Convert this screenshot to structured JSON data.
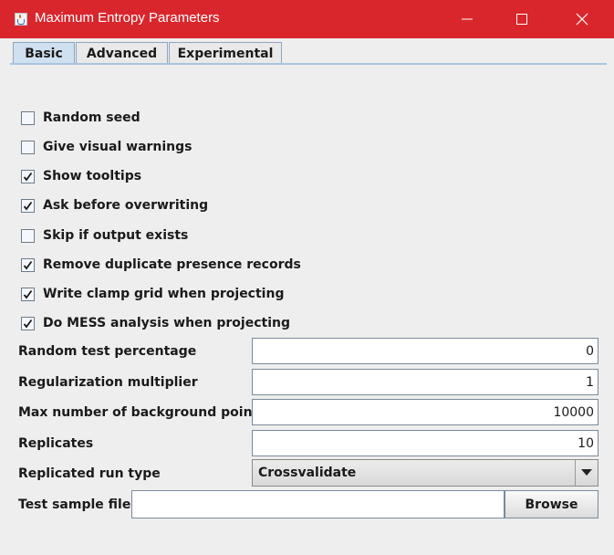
{
  "window": {
    "title": "Maximum Entropy Parameters",
    "icon": "java-cup-icon",
    "controls": [
      "minimize-icon",
      "maximize-icon",
      "close-icon"
    ],
    "titlebar_color": "#d9262c"
  },
  "tabs": [
    {
      "label": "Basic",
      "selected": true
    },
    {
      "label": "Advanced",
      "selected": false
    },
    {
      "label": "Experimental",
      "selected": false
    }
  ],
  "checkboxes": [
    {
      "label": "Random seed",
      "checked": false
    },
    {
      "label": "Give visual warnings",
      "checked": false
    },
    {
      "label": "Show tooltips",
      "checked": true
    },
    {
      "label": "Ask before overwriting",
      "checked": true
    },
    {
      "label": "Skip if output exists",
      "checked": false
    },
    {
      "label": "Remove duplicate presence records",
      "checked": true
    },
    {
      "label": "Write clamp grid when projecting",
      "checked": true
    },
    {
      "label": "Do MESS analysis when projecting",
      "checked": true
    }
  ],
  "fields": [
    {
      "label": "Random test percentage",
      "value": "0"
    },
    {
      "label": "Regularization multiplier",
      "value": "1"
    },
    {
      "label": "Max number of background points",
      "value": "10000"
    },
    {
      "label": "Replicates",
      "value": "10"
    }
  ],
  "run_type": {
    "label": "Replicated run type",
    "value": "Crossvalidate"
  },
  "test_sample": {
    "label": "Test sample file",
    "value": "",
    "button_label": "Browse"
  }
}
